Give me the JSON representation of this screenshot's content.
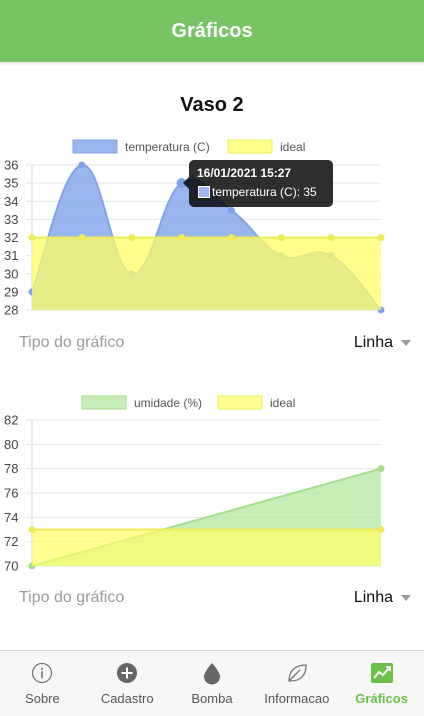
{
  "header": {
    "title": "Gráficos"
  },
  "page": {
    "title": "Vaso 2"
  },
  "selector": {
    "label": "Tipo do gráfico",
    "value": "Linha"
  },
  "tooltip": {
    "title": "16/01/2021 15:27",
    "body": "temperatura (C): 35"
  },
  "colors": {
    "header": "#78c465",
    "temperature": "#7fa3ea",
    "humidity": "#b5e89f",
    "ideal": "#ffff66",
    "active_tab": "#6cc04a"
  },
  "tabs": [
    {
      "label": "Sobre",
      "icon": "info-icon"
    },
    {
      "label": "Cadastro",
      "icon": "add-circle-icon"
    },
    {
      "label": "Bomba",
      "icon": "water-drop-icon"
    },
    {
      "label": "Informacao",
      "icon": "leaf-icon"
    },
    {
      "label": "Gráficos",
      "icon": "line-chart-icon",
      "active": true
    }
  ],
  "chart_data": [
    {
      "type": "area",
      "x": [
        1,
        2,
        3,
        4,
        5,
        6,
        7,
        8
      ],
      "ylim": [
        28,
        36
      ],
      "yticks": [
        "28",
        "29",
        "30",
        "31",
        "32",
        "33",
        "34",
        "35",
        "36"
      ],
      "grid": true,
      "legend_position": "top",
      "series": [
        {
          "name": "temperatura (C)",
          "values": [
            29,
            36,
            30,
            35,
            33.5,
            31,
            31,
            28
          ]
        },
        {
          "name": "ideal",
          "values": [
            32,
            32,
            32,
            32,
            32,
            32,
            32,
            32
          ]
        }
      ]
    },
    {
      "type": "area",
      "x": [
        1,
        2
      ],
      "ylim": [
        70,
        82
      ],
      "yticks": [
        "70",
        "72",
        "74",
        "76",
        "78",
        "80",
        "82"
      ],
      "grid": true,
      "legend_position": "top",
      "series": [
        {
          "name": "umidade (%)",
          "values": [
            70,
            78
          ]
        },
        {
          "name": "ideal",
          "values": [
            73,
            73
          ]
        }
      ]
    }
  ]
}
